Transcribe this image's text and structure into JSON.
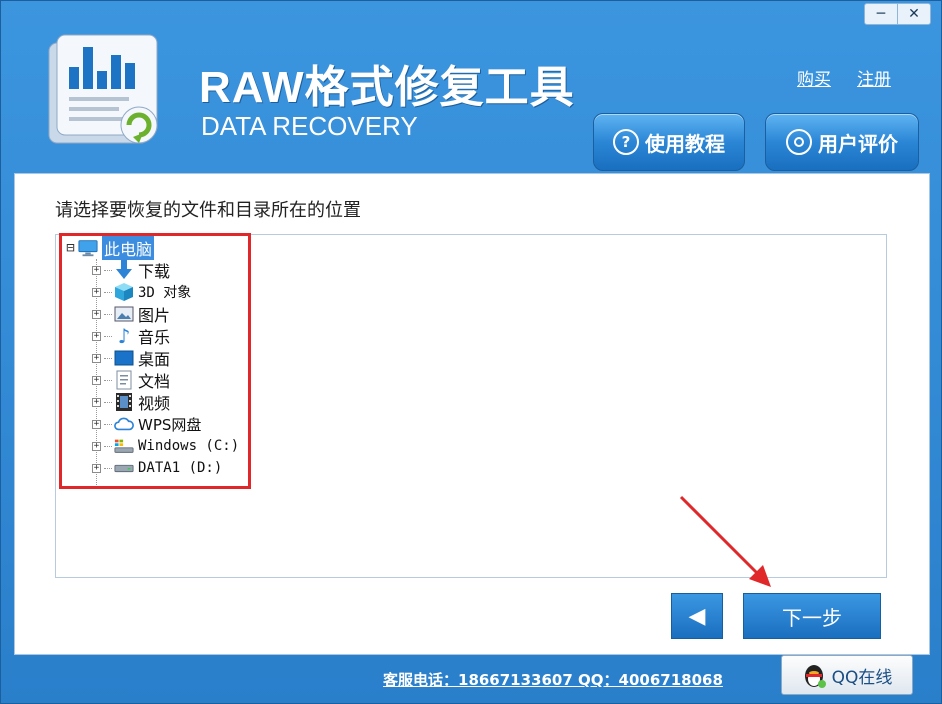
{
  "window": {
    "controls": {
      "minimize": "─",
      "close": "✕"
    }
  },
  "header": {
    "app_title": "RAW格式修复工具",
    "app_subtitle": "DATA RECOVERY",
    "links": {
      "buy": "购买",
      "register": "注册"
    },
    "buttons": {
      "tutorial": "使用教程",
      "reviews": "用户评价"
    },
    "tutorial_icon_glyph": "?",
    "colors": {
      "header_bg": "#2f86d0",
      "highlight_red": "#e0282b"
    }
  },
  "main": {
    "instruction": "请选择要恢复的文件和目录所在的位置",
    "tree": {
      "root": {
        "label": "此电脑",
        "expander": "⊟",
        "icon": "monitor-icon"
      },
      "items": [
        {
          "label": "下载",
          "icon": "download-arrow-icon"
        },
        {
          "label": "3D 对象",
          "icon": "cube-icon"
        },
        {
          "label": "图片",
          "icon": "picture-icon"
        },
        {
          "label": "音乐",
          "icon": "music-note-icon"
        },
        {
          "label": "桌面",
          "icon": "desktop-icon"
        },
        {
          "label": "文档",
          "icon": "document-icon"
        },
        {
          "label": "视频",
          "icon": "film-icon"
        },
        {
          "label": "WPS网盘",
          "icon": "cloud-icon"
        },
        {
          "label": "Windows (C:)",
          "icon": "system-drive-icon"
        },
        {
          "label": "DATA1 (D:)",
          "icon": "drive-icon"
        }
      ],
      "expander_collapsed": "+"
    },
    "nav": {
      "back_glyph": "◀",
      "next_label": "下一步"
    }
  },
  "footer": {
    "contact": "客服电话：18667133607 QQ：4006718068",
    "qq_button": "QQ在线"
  }
}
